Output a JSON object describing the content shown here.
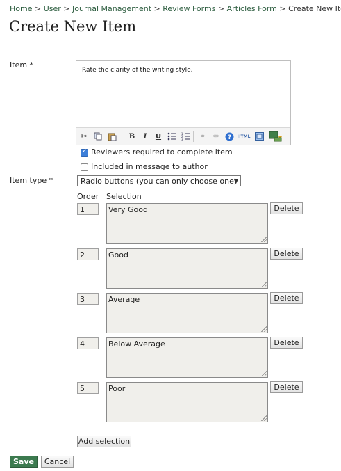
{
  "breadcrumb": {
    "items": [
      "Home",
      "User",
      "Journal Management",
      "Review Forms",
      "Articles Form"
    ],
    "current": "Create New Item",
    "separator": ">"
  },
  "page_title": "Create New Item",
  "item": {
    "label": "Item *",
    "text": "Rate the clarity of the writing style.",
    "toolbar_icons": [
      "cut-icon",
      "copy-icon",
      "paste-icon",
      "bold-icon",
      "italic-icon",
      "underline-icon",
      "bullet-list-icon",
      "numbered-list-icon",
      "link-icon",
      "unlink-icon",
      "help-icon",
      "html-icon",
      "fullscreen-icon",
      "image-upload-icon"
    ]
  },
  "checkboxes": [
    {
      "label": "Reviewers required to complete item",
      "checked": true
    },
    {
      "label": "Included in message to author",
      "checked": false
    }
  ],
  "item_type": {
    "label": "Item type *",
    "selected": "Radio buttons (you can only choose one)"
  },
  "table": {
    "order_header": "Order",
    "selection_header": "Selection",
    "rows": [
      {
        "order": "1",
        "selection": "Very Good"
      },
      {
        "order": "2",
        "selection": "Good"
      },
      {
        "order": "3",
        "selection": "Average"
      },
      {
        "order": "4",
        "selection": "Below Average"
      },
      {
        "order": "5",
        "selection": "Poor"
      }
    ],
    "delete_label": "Delete"
  },
  "add_selection_label": "Add selection",
  "save_label": "Save",
  "cancel_label": "Cancel",
  "colors": {
    "link": "#2e5e40",
    "save_button": "#3c7a4f",
    "checkbox_checked": "#3d7fd9"
  }
}
